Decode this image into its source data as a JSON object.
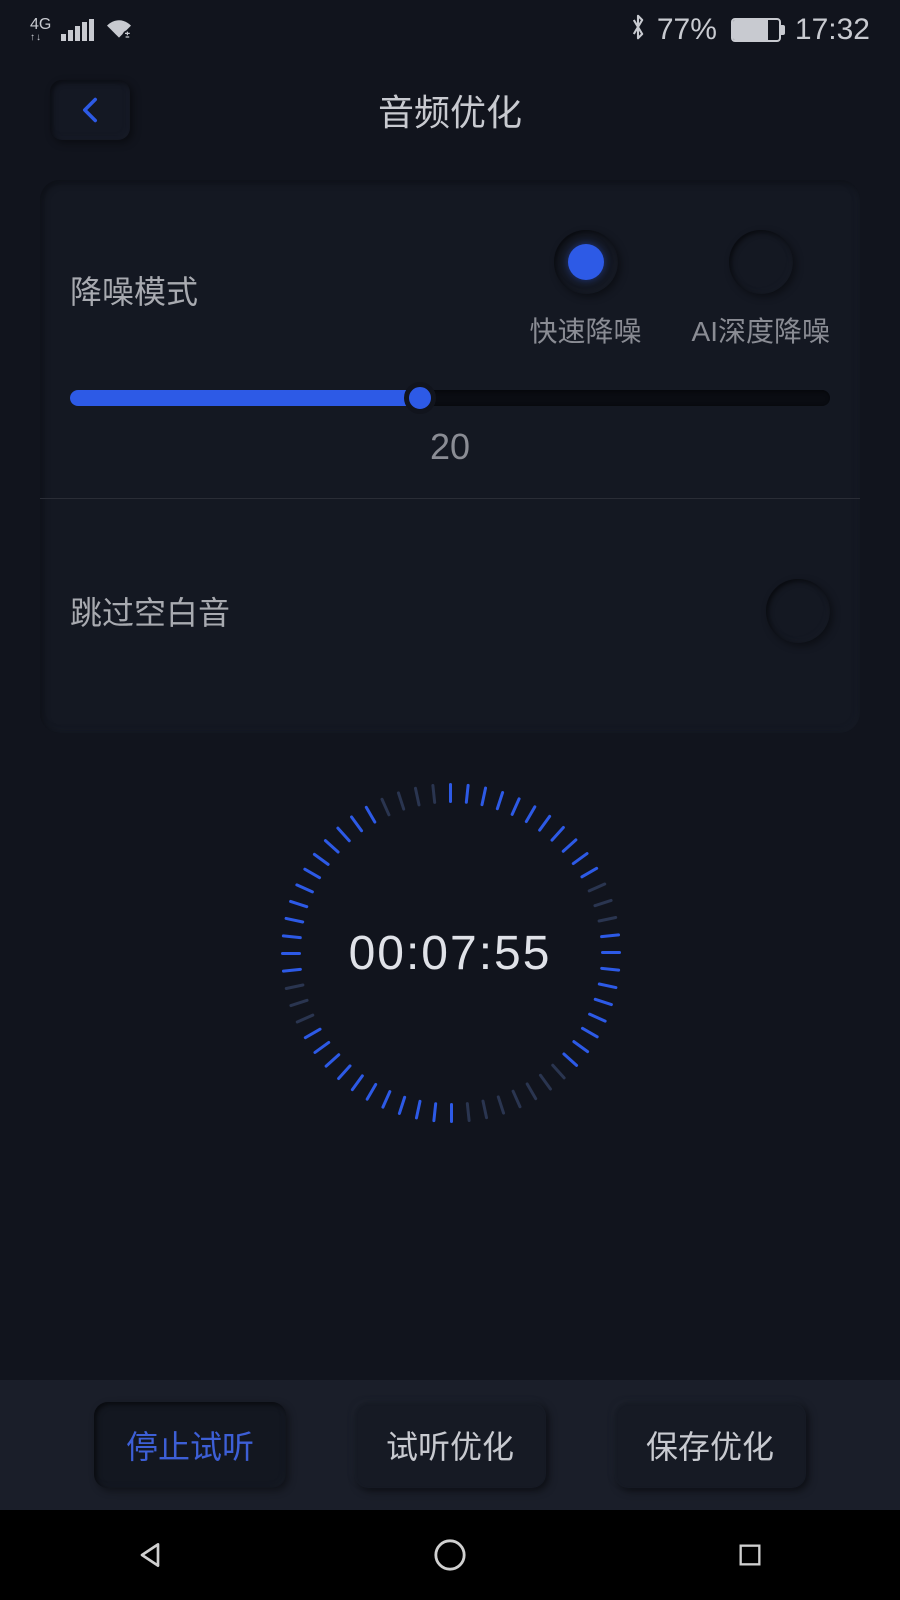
{
  "status": {
    "network": "4G",
    "bluetooth": true,
    "battery_percent": "77%",
    "time": "17:32"
  },
  "header": {
    "title": "音频优化"
  },
  "noise": {
    "label": "降噪模式",
    "option_fast": "快速降噪",
    "option_ai": "AI深度降噪",
    "slider_value": "20"
  },
  "skip": {
    "label": "跳过空白音"
  },
  "timer": {
    "value": "00:07:55"
  },
  "buttons": {
    "stop": "停止试听",
    "preview": "试听优化",
    "save": "保存优化"
  }
}
